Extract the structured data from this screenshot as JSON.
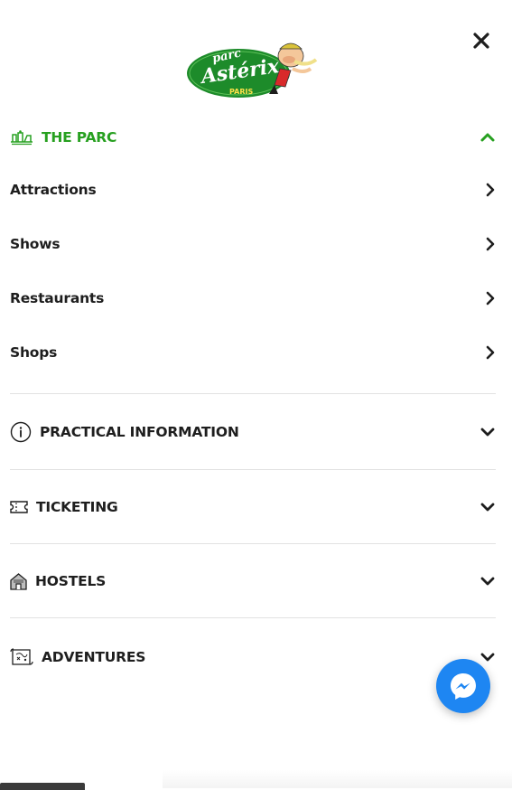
{
  "header": {
    "logo": {
      "text_top": "parc",
      "text_main": "Astérix",
      "text_sub": "PARIS"
    },
    "close_icon": "close-icon"
  },
  "colors": {
    "accent": "#27a020",
    "text": "#1e1e1e",
    "divider": "#e2e2e2",
    "messenger": "#1e86f2"
  },
  "menu": {
    "parc": {
      "label": "THE PARC",
      "icon": "ride-icon",
      "expanded": true,
      "items": [
        {
          "label": "Attractions"
        },
        {
          "label": "Shows"
        },
        {
          "label": "Restaurants"
        },
        {
          "label": "Shops"
        }
      ]
    },
    "practical": {
      "label": "PRACTICAL INFORMATION",
      "icon": "info-icon"
    },
    "ticketing": {
      "label": "TICKETING",
      "icon": "ticket-icon"
    },
    "hostels": {
      "label": "HOSTELS",
      "icon": "hostel-icon"
    },
    "adventures": {
      "label": "ADVENTURES",
      "icon": "map-icon"
    }
  },
  "chat": {
    "icon": "messenger-icon"
  }
}
